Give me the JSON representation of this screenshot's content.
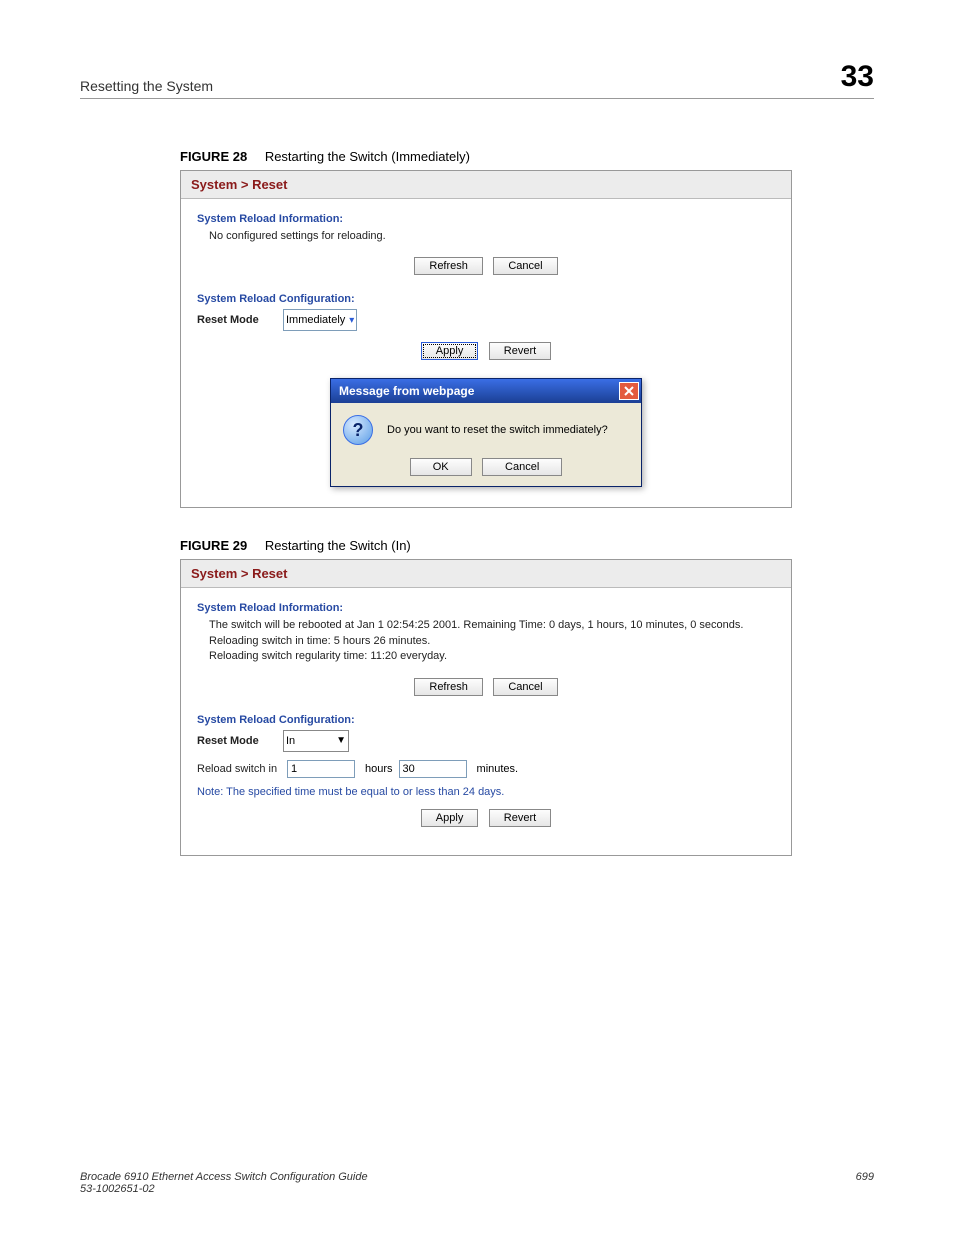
{
  "header": {
    "section_title": "Resetting the System",
    "chapter_number": "33"
  },
  "figure28": {
    "label": "FIGURE 28",
    "caption": "Restarting the Switch (Immediately)",
    "panel_title": "System > Reset",
    "info_heading": "System Reload Information:",
    "info_text": "No configured settings for reloading.",
    "refresh_label": "Refresh",
    "cancel_label": "Cancel",
    "config_heading": "System Reload Configuration:",
    "reset_mode_label": "Reset Mode",
    "reset_mode_value": "Immediately",
    "apply_label": "Apply",
    "revert_label": "Revert",
    "dialog": {
      "title": "Message from webpage",
      "message": "Do you want to reset the switch immediately?",
      "ok_label": "OK",
      "cancel_label": "Cancel"
    }
  },
  "figure29": {
    "label": "FIGURE 29",
    "caption": "Restarting the Switch (In)",
    "panel_title": "System > Reset",
    "info_heading": "System Reload Information:",
    "info_line1": "The switch will be rebooted at Jan 1 02:54:25 2001. Remaining Time: 0 days, 1 hours, 10 minutes, 0 seconds.",
    "info_line2": "Reloading switch in time: 5 hours 26 minutes.",
    "info_line3": "Reloading switch regularity time: 11:20 everyday.",
    "refresh_label": "Refresh",
    "cancel_label": "Cancel",
    "config_heading": "System Reload Configuration:",
    "reset_mode_label": "Reset Mode",
    "reset_mode_value": "In",
    "reload_label": "Reload switch in",
    "hours_value": "1",
    "hours_label": "hours",
    "minutes_value": "30",
    "minutes_label": "minutes.",
    "note": "Note: The specified time must be equal to or less than 24 days.",
    "apply_label": "Apply",
    "revert_label": "Revert"
  },
  "footer": {
    "line1": "Brocade 6910 Ethernet Access Switch Configuration Guide",
    "line2": "53-1002651-02",
    "page": "699"
  }
}
